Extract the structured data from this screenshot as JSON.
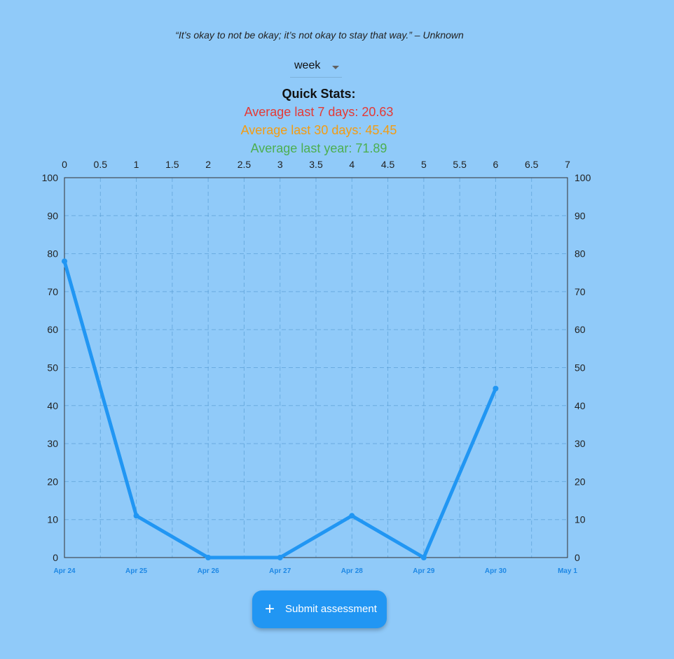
{
  "quote": "“It’s okay to not be okay; it’s not okay to stay that way.” – Unknown",
  "period_select": {
    "value": "week"
  },
  "quick_stats": {
    "title": "Quick Stats:",
    "avg_7": "Average last 7 days: 20.63",
    "avg_30": "Average last 30 days: 45.45",
    "avg_year": "Average last year: 71.89"
  },
  "colors": {
    "background": "#90caf9",
    "line": "#2196f3",
    "avg_7": "#e53935",
    "avg_30": "#f39c12",
    "avg_year": "#4caf50"
  },
  "chart_data": {
    "type": "line",
    "x_top_ticks": [
      "0",
      "0.5",
      "1",
      "1.5",
      "2",
      "2.5",
      "3",
      "3.5",
      "4",
      "4.5",
      "5",
      "5.5",
      "6",
      "6.5",
      "7"
    ],
    "x_bottom_labels": [
      "Apr 24",
      "Apr 25",
      "Apr 26",
      "Apr 27",
      "Apr 28",
      "Apr 29",
      "Apr 30",
      "May 1"
    ],
    "y_ticks": [
      "0",
      "10",
      "20",
      "30",
      "40",
      "50",
      "60",
      "70",
      "80",
      "90",
      "100"
    ],
    "ylim": [
      0,
      100
    ],
    "xlim": [
      0,
      7
    ],
    "grid": true,
    "series": [
      {
        "x": [
          0,
          1,
          2,
          3,
          4,
          5,
          6
        ],
        "values": [
          78,
          11,
          0,
          0,
          11,
          0,
          44.5
        ]
      }
    ]
  },
  "fab": {
    "icon": "plus-icon",
    "label": "Submit assessment"
  }
}
